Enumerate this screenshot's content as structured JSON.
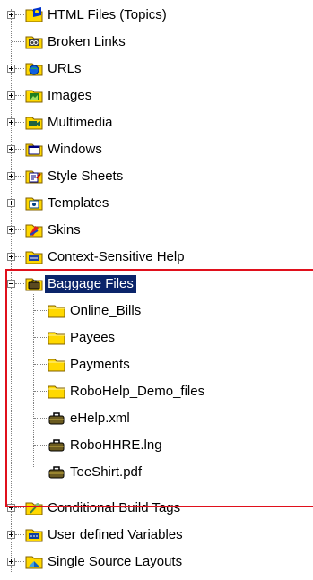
{
  "tree": {
    "items": [
      {
        "label": "HTML Files (Topics)",
        "icon": "html-files-folder-icon"
      },
      {
        "label": "Broken Links",
        "icon": "broken-links-icon"
      },
      {
        "label": "URLs",
        "icon": "urls-globe-icon"
      },
      {
        "label": "Images",
        "icon": "images-folder-icon"
      },
      {
        "label": "Multimedia",
        "icon": "multimedia-folder-icon"
      },
      {
        "label": "Windows",
        "icon": "windows-icon"
      },
      {
        "label": "Style Sheets",
        "icon": "style-sheets-icon"
      },
      {
        "label": "Templates",
        "icon": "templates-icon"
      },
      {
        "label": "Skins",
        "icon": "skins-icon"
      },
      {
        "label": "Context-Sensitive Help",
        "icon": "context-sensitive-help-icon"
      },
      {
        "label": "Baggage Files",
        "icon": "baggage-files-folder-icon",
        "selected": true,
        "expanded": true
      },
      {
        "label": "Online_Bills",
        "icon": "folder-icon",
        "child": true
      },
      {
        "label": "Payees",
        "icon": "folder-icon",
        "child": true
      },
      {
        "label": "Payments",
        "icon": "folder-icon",
        "child": true
      },
      {
        "label": "RoboHelp_Demo_files",
        "icon": "folder-icon",
        "child": true
      },
      {
        "label": "eHelp.xml",
        "icon": "baggage-file-icon",
        "child": true
      },
      {
        "label": "RoboHHRE.lng",
        "icon": "baggage-file-icon",
        "child": true
      },
      {
        "label": "TeeShirt.pdf",
        "icon": "baggage-file-icon",
        "child": true
      },
      {
        "label": "Conditional Build Tags",
        "icon": "conditional-build-tags-icon"
      },
      {
        "label": "User defined Variables",
        "icon": "variables-icon"
      },
      {
        "label": "Single Source Layouts",
        "icon": "single-source-layouts-icon"
      }
    ]
  },
  "colors": {
    "selection": "#0a246a",
    "highlight_box": "#e0101c",
    "folder_yellow": "#ffd800"
  }
}
